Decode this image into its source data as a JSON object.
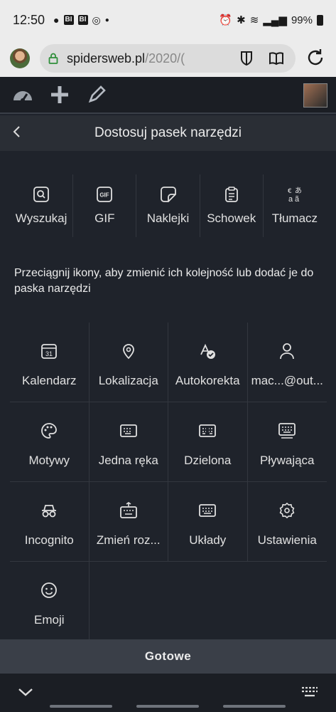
{
  "status_bar": {
    "time": "12:50",
    "battery": "99%",
    "box_icons": [
      "BI",
      "BI"
    ]
  },
  "browser": {
    "url_main": "spidersweb.pl",
    "url_path": "/2020/("
  },
  "header": {
    "title": "Dostosuj pasek narzędzi"
  },
  "toolbar_items": [
    {
      "label": "Wyszukaj",
      "icon": "search-icon"
    },
    {
      "label": "GIF",
      "icon": "gif-icon",
      "icon_text": "GIF"
    },
    {
      "label": "Naklejki",
      "icon": "sticker-icon"
    },
    {
      "label": "Schowek",
      "icon": "clipboard-icon"
    },
    {
      "label": "Tłumacz",
      "icon": "translate-icon"
    }
  ],
  "instruction": "Przeciągnij ikony, aby zmienić ich kolejność lub dodać je do paska narzędzi",
  "grid_items": [
    {
      "label": "Kalendarz",
      "icon": "calendar-icon",
      "icon_text": "31"
    },
    {
      "label": "Lokalizacja",
      "icon": "location-icon"
    },
    {
      "label": "Autokorekta",
      "icon": "autocorrect-icon"
    },
    {
      "label": "mac...@out...",
      "icon": "person-icon"
    },
    {
      "label": "Motywy",
      "icon": "palette-icon"
    },
    {
      "label": "Jedna ręka",
      "icon": "one-hand-keyboard-icon"
    },
    {
      "label": "Dzielona",
      "icon": "split-keyboard-icon"
    },
    {
      "label": "Pływająca",
      "icon": "floating-keyboard-icon"
    },
    {
      "label": "Incognito",
      "icon": "incognito-icon"
    },
    {
      "label": "Zmień roz...",
      "icon": "resize-keyboard-icon"
    },
    {
      "label": "Układy",
      "icon": "layouts-icon"
    },
    {
      "label": "Ustawienia",
      "icon": "settings-icon"
    },
    {
      "label": "Emoji",
      "icon": "emoji-icon"
    }
  ],
  "done_button": "Gotowe",
  "colors": {
    "background": "#1f232b",
    "header": "#2a2e35",
    "done_bar": "#3a3f48",
    "status_bar": "#ececec"
  }
}
